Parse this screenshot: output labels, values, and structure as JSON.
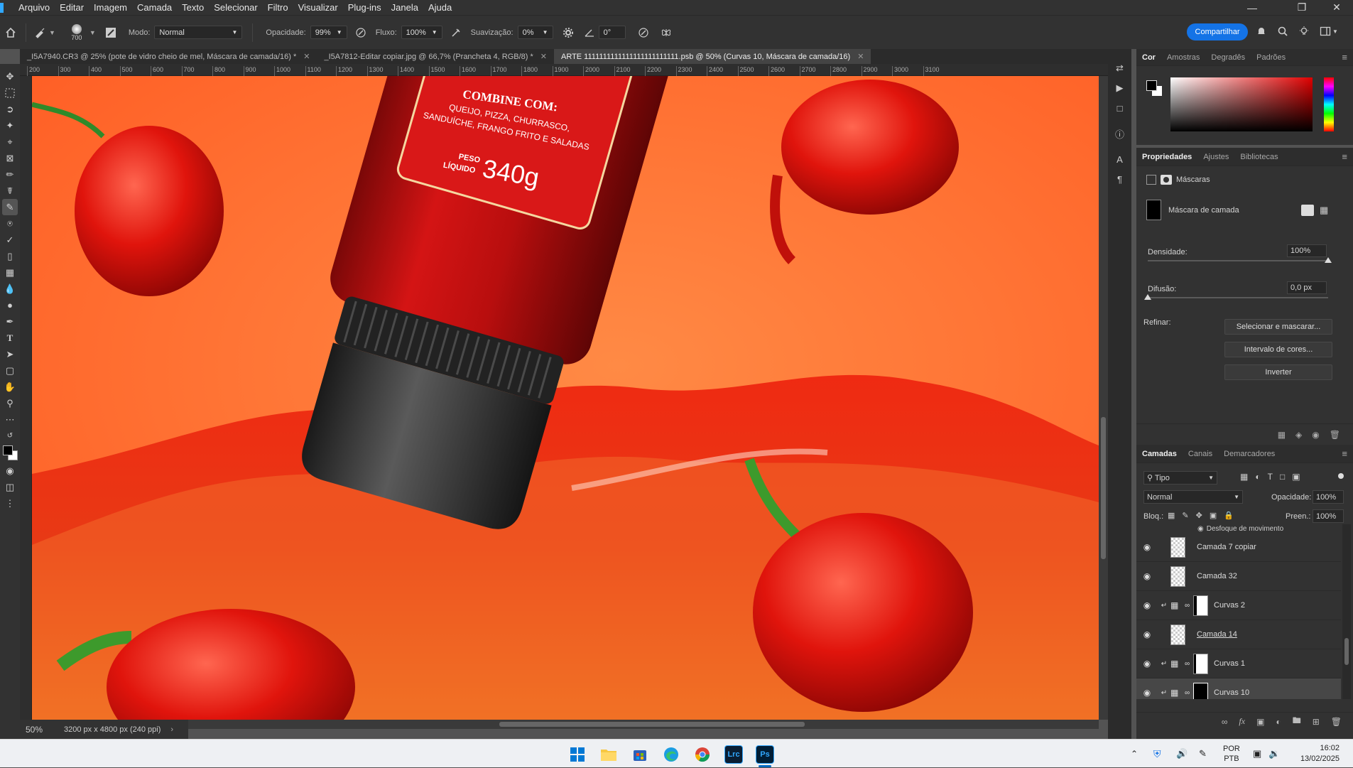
{
  "menu": [
    "Arquivo",
    "Editar",
    "Imagem",
    "Camada",
    "Texto",
    "Selecionar",
    "Filtro",
    "Visualizar",
    "Plug-ins",
    "Janela",
    "Ajuda"
  ],
  "options": {
    "brush_size": "700",
    "mode_label": "Modo:",
    "mode_value": "Normal",
    "opacity_label": "Opacidade:",
    "opacity_value": "99%",
    "flow_label": "Fluxo:",
    "flow_value": "100%",
    "smoothing_label": "Suavização:",
    "smoothing_value": "0%",
    "angle_value": "0°",
    "share_label": "Compartilhar"
  },
  "tabs": [
    {
      "label": "_I5A7940.CR3 @ 25% (pote de vidro cheio de mel, Máscara de camada/16) *"
    },
    {
      "label": "_I5A7812-Editar copiar.jpg @ 66,7% (Prancheta 4, RGB/8) *"
    },
    {
      "label": "ARTE 1111111111111111111111111.psb @ 50% (Curvas 10, Máscara de camada/16)"
    }
  ],
  "ruler_ticks": [
    "200",
    "300",
    "400",
    "500",
    "600",
    "700",
    "800",
    "900",
    "1000",
    "1100",
    "1200",
    "1300",
    "1400",
    "1500",
    "1600",
    "1700",
    "1800",
    "1900",
    "2000",
    "2100",
    "2200",
    "2300",
    "2400",
    "2500",
    "2600",
    "2700",
    "2800",
    "2900",
    "3000",
    "3100"
  ],
  "canvas_text": {
    "line1": "COMBINE COM:",
    "line2": "QUEIJO, PIZZA, CHURRASCO,",
    "line3": "SANDUÍCHE, FRANGO FRITO E SALADAS",
    "weight_label1": "PESO",
    "weight_label2": "LÍQUIDO",
    "weight_value": "340g"
  },
  "status": {
    "zoom": "50%",
    "doc_size": "3200 px x 4800 px (240 ppi)"
  },
  "color_panel": {
    "tabs": [
      "Cor",
      "Amostras",
      "Degradês",
      "Padrões"
    ]
  },
  "properties": {
    "tabs": [
      "Propriedades",
      "Ajustes",
      "Bibliotecas"
    ],
    "section": "Máscaras",
    "mask_label": "Máscara de camada",
    "density_label": "Densidade:",
    "density_value": "100%",
    "density_fraction": 1.0,
    "feather_label": "Difusão:",
    "feather_value": "0,0 px",
    "feather_fraction": 0.0,
    "refine_label": "Refinar:",
    "btn_select_mask": "Selecionar e mascarar...",
    "btn_color_range": "Intervalo de cores...",
    "btn_invert": "Inverter"
  },
  "layers": {
    "tabs": [
      "Camadas",
      "Canais",
      "Demarcadores"
    ],
    "filter_label": "Tipo",
    "blend_value": "Normal",
    "opacity_label": "Opacidade:",
    "opacity_value": "100%",
    "lock_label": "Bloq.:",
    "fill_label": "Preen.:",
    "fill_value": "100%",
    "partial_row": "Desfoque de movimento",
    "items": [
      {
        "name": "Camada 7 copiar",
        "type": "pixel"
      },
      {
        "name": "Camada 32",
        "type": "pixel"
      },
      {
        "name": "Curvas 2",
        "type": "adjust"
      },
      {
        "name": "Camada 14",
        "type": "pixel"
      },
      {
        "name": "Curvas 1",
        "type": "adjust"
      },
      {
        "name": "Curvas 10",
        "type": "adjust",
        "selected": true
      }
    ]
  },
  "taskbar": {
    "lang_line1": "POR",
    "lang_line2": "PTB",
    "time": "16:02",
    "date": "13/02/2025",
    "app_lrc": "Lrc",
    "app_ps": "Ps"
  }
}
